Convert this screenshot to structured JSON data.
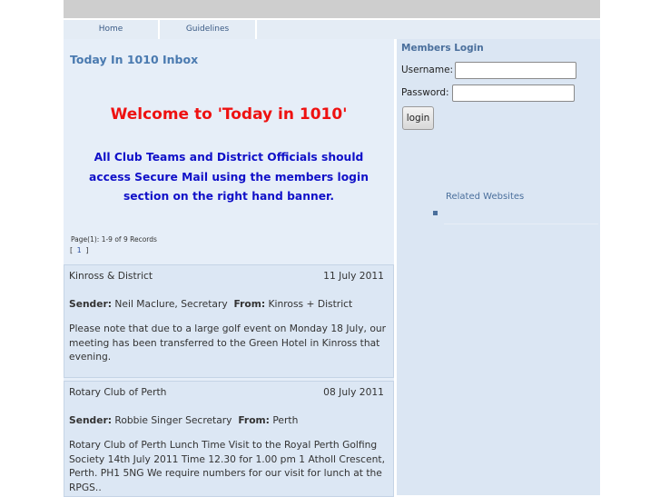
{
  "nav": {
    "items": [
      "Home",
      "Guidelines"
    ]
  },
  "inbox": {
    "title": "Today In 1010 Inbox",
    "welcome": "Welcome to 'Today in 1010'",
    "notice": "All Club Teams and District Officials should access Secure Mail using the members login section on the right hand banner.",
    "pager_text": "Page(1): 1-9 of 9 Records",
    "pager_links": {
      "open": "[",
      "page": "1",
      "close": "]"
    }
  },
  "messages": [
    {
      "from": "Kinross & District",
      "date": "11 July 2011",
      "sender_label": "Sender:",
      "sender": "Neil Maclure, Secretary",
      "from_label": "From:",
      "from_value": "Kinross + District",
      "body": "Please note that due to a large golf event on Monday 18 July, our meeting has been transferred to the Green Hotel in Kinross that evening."
    },
    {
      "from": "Rotary Club of Perth",
      "date": "08 July 2011",
      "sender_label": "Sender:",
      "sender": "Robbie Singer Secretary",
      "from_label": "From:",
      "from_value": "Perth",
      "body": "Rotary Club of Perth Lunch Time Visit to the Royal Perth Golfing Society 14th July 2011 Time 12.30 for 1.00 pm 1 Atholl Crescent, Perth. PH1 5NG We require numbers for our visit for lunch at the RPGS.."
    }
  ],
  "login": {
    "title": "Members Login",
    "username_label": "Username:",
    "password_label": "Password:",
    "username_value": "",
    "password_value": "",
    "button_label": "login"
  },
  "related": {
    "title": "Related Websites"
  },
  "colors": {
    "welcome": "#ee1111",
    "notice": "#1010c8",
    "accent": "#4a7ab0"
  }
}
